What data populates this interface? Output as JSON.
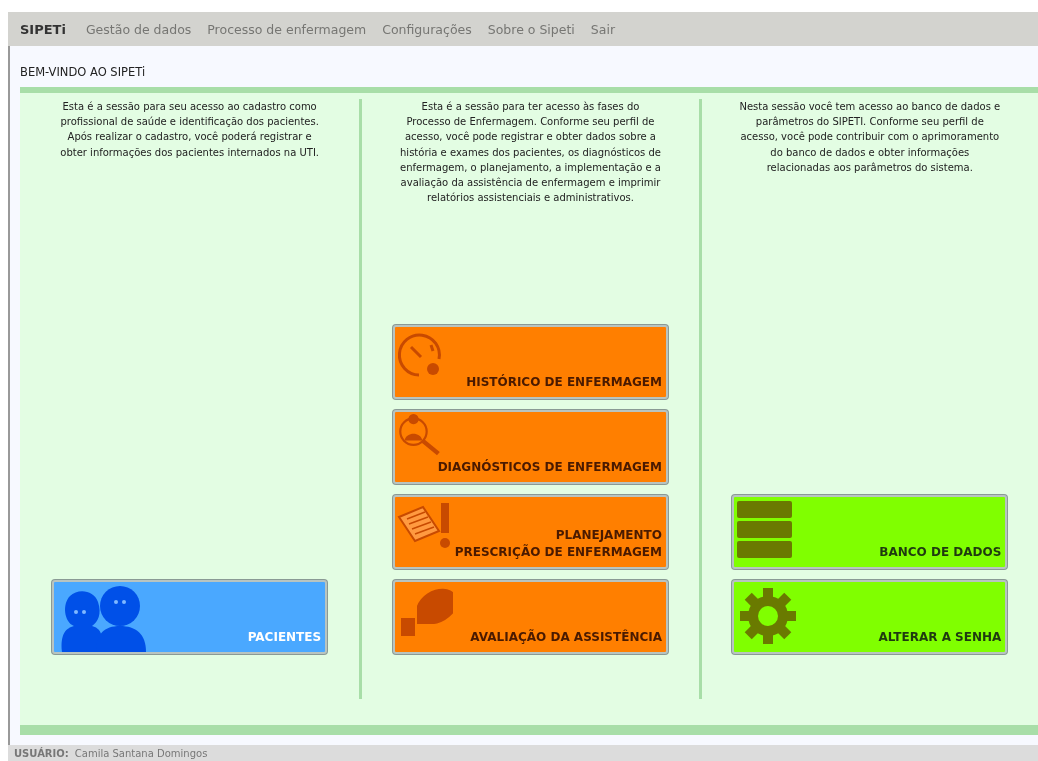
{
  "nav": {
    "brand": "SIPETi",
    "items": [
      "Gestão de dados",
      "Processo de enfermagem",
      "Configurações",
      "Sobre o Sipeti",
      "Sair"
    ]
  },
  "page_title": "BEM-VINDO AO SIPETi",
  "columns": [
    {
      "text": "Esta é a sessão para seu acesso ao cadastro como profissional de saúde e identificação dos pacientes. Após realizar o cadastro, você poderá registrar e obter informações dos pacientes internados na UTI.",
      "buttons": [
        {
          "kind": "patients",
          "color": "#4aa8ff",
          "label": "PACIENTES"
        }
      ]
    },
    {
      "text": "Esta é a sessão para ter acesso às fases do Processo de Enfermagem. Conforme seu perfil de acesso, você pode registrar e obter dados sobre a história e exames dos pacientes, os diagnósticos de enfermagem, o planejamento, a implementação e a avaliação da assistência de enfermagem e imprimir relatórios assistenciais e administrativos.",
      "buttons": [
        {
          "kind": "history",
          "color": "#ff7f00",
          "label": "HISTÓRICO DE ENFERMAGEM"
        },
        {
          "kind": "diagnosis",
          "color": "#ff7f00",
          "label": "DIAGNÓSTICOS DE ENFERMAGEM"
        },
        {
          "kind": "planning",
          "color": "#ff7f00",
          "label": "PLANEJAMENTO\nPRESCRIÇÃO DE ENFERMAGEM"
        },
        {
          "kind": "evaluation",
          "color": "#ff7f00",
          "label": "AVALIAÇÃO DA ASSISTÊNCIA"
        }
      ]
    },
    {
      "text": "Nesta sessão você tem acesso ao banco de dados e parâmetros do SIPETI. Conforme seu perfil de acesso, você pode contribuir com o aprimoramento do banco de dados e obter informações relacionadas aos parâmetros do sistema.",
      "buttons": [
        {
          "kind": "database",
          "color": "#80ff00",
          "label": "BANCO DE DADOS"
        },
        {
          "kind": "settings",
          "color": "#80ff00",
          "label": "ALTERAR A SENHA"
        }
      ]
    }
  ],
  "footer": {
    "label": "USUÁRIO:",
    "user": "Camila Santana Domingos"
  }
}
